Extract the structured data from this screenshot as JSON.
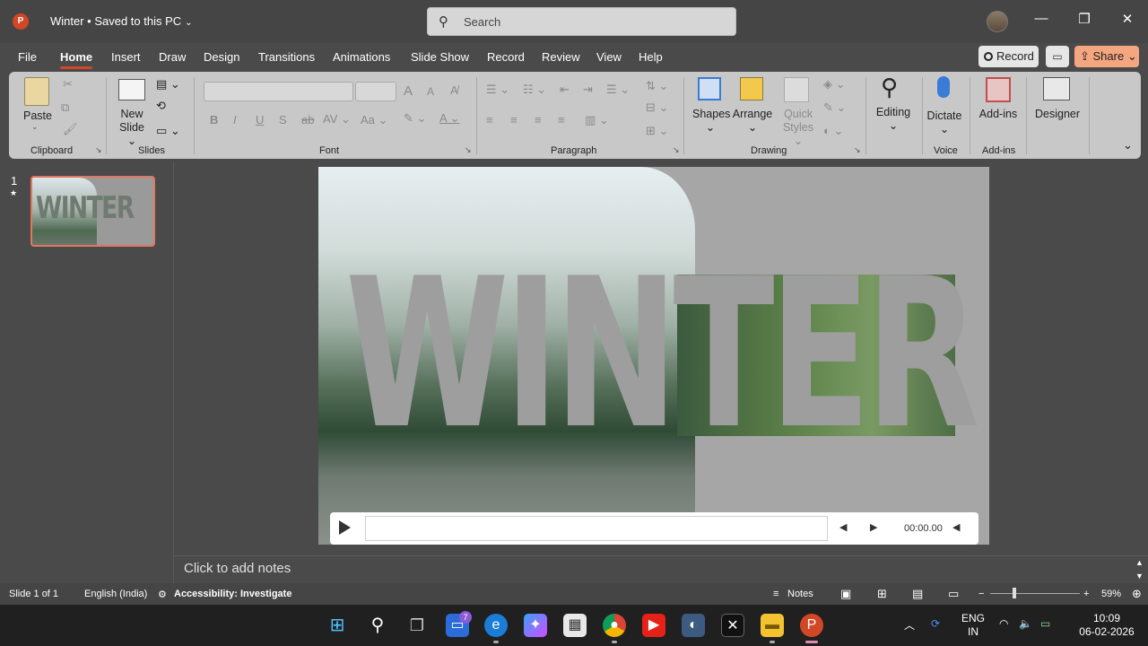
{
  "titlebar": {
    "app_icon": "P",
    "doc_title": "Winter • Saved to this PC",
    "search_placeholder": "Search",
    "minimize": "—",
    "restore": "❐",
    "close": "✕"
  },
  "tabs": [
    "File",
    "Home",
    "Insert",
    "Draw",
    "Design",
    "Transitions",
    "Animations",
    "Slide Show",
    "Record",
    "Review",
    "View",
    "Help"
  ],
  "active_tab": "Home",
  "actions": {
    "record": "Record",
    "share": "Share"
  },
  "ribbon": {
    "clipboard": {
      "paste": "Paste",
      "label": "Clipboard"
    },
    "slides": {
      "new_slide_1": "New",
      "new_slide_2": "Slide",
      "label": "Slides"
    },
    "font": {
      "label": "Font",
      "bold": "B",
      "italic": "I",
      "underline": "U",
      "shadow": "S",
      "strike": "ab",
      "spacing": "AV",
      "case": "Aa",
      "grow": "A",
      "shrink": "A"
    },
    "paragraph": {
      "label": "Paragraph"
    },
    "drawing": {
      "shapes": "Shapes",
      "arrange": "Arrange",
      "quick1": "Quick",
      "quick2": "Styles",
      "label": "Drawing"
    },
    "editing": {
      "label": "Editing"
    },
    "voice": {
      "dictate": "Dictate",
      "label": "Voice"
    },
    "addins": {
      "button": "Add-ins",
      "label": "Add-ins"
    },
    "designer": {
      "label": "Designer"
    }
  },
  "thumbnails": [
    {
      "number": "1",
      "star": "★",
      "word": "WINTER"
    }
  ],
  "slide": {
    "word": "WINTER"
  },
  "media": {
    "time": "00:00.00"
  },
  "notes_placeholder": "Click to add notes",
  "statusbar": {
    "slide": "Slide 1 of 1",
    "language": "English (India)",
    "accessibility": "Accessibility: Investigate",
    "notes": "Notes",
    "zoom": "59%"
  },
  "taskbar": {
    "badge": "7",
    "lang1": "ENG",
    "lang2": "IN",
    "time": "10:09",
    "date": "06-02-2026"
  }
}
